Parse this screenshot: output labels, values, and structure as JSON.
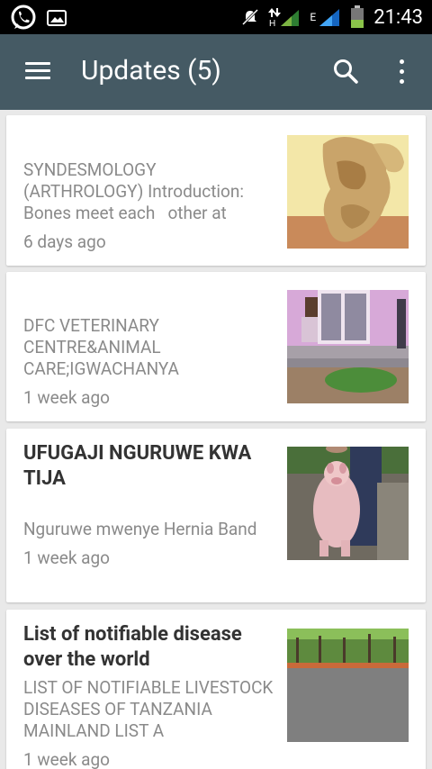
{
  "status_bar": {
    "time": "21:43",
    "network_label": "E"
  },
  "app_bar": {
    "title": "Updates (5)"
  },
  "posts": [
    {
      "title": "",
      "description": "SYNDESMOLOGY (ARTHROLOGY) Introduction: Bones meet each   other at",
      "time": "6 days ago",
      "thumbnail": "bone-photo"
    },
    {
      "title": "",
      "description": "DFC VETERINARY CENTRE&ANIMAL CARE;IGWACHANYA",
      "time": "1 week ago",
      "thumbnail": "clinic-building-photo"
    },
    {
      "title": "UFUGAJI NGURUWE KWA TIJA",
      "description": "Nguruwe mwenye Hernia Band",
      "time": "1 week ago",
      "thumbnail": "pig-photo"
    },
    {
      "title": "List of notifiable disease over the world",
      "description": "LIST OF NOTIFIABLE LIVESTOCK DISEASES OF TANZANIA MAINLAND LIST A",
      "time": "1 week ago",
      "thumbnail": "trees-photo"
    }
  ],
  "colors": {
    "app_bar": "#455a64",
    "background": "#e9e9e9",
    "card": "#ffffff",
    "muted_text": "#8a8a8a",
    "title_text": "#333333"
  },
  "icons": [
    "whatsapp-icon",
    "image-icon",
    "mute-icon",
    "data-arrows-icon",
    "signal-icon",
    "battery-icon",
    "menu-icon",
    "search-icon",
    "more-vert-icon"
  ]
}
